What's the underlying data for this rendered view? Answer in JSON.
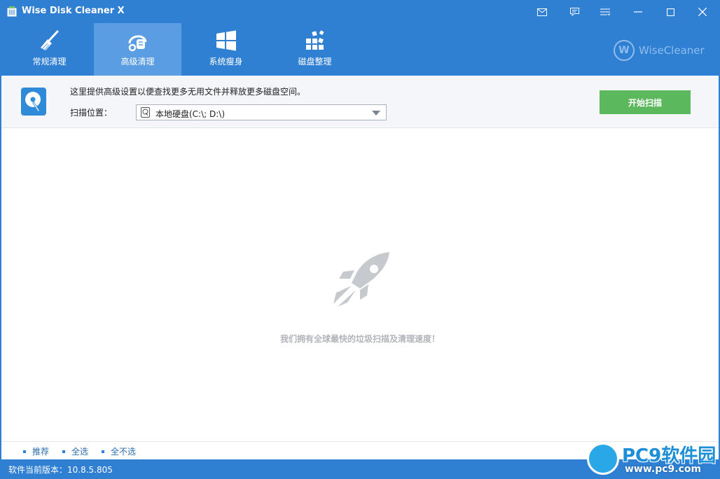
{
  "window": {
    "title": "Wise Disk Cleaner X"
  },
  "titlebar_buttons": [
    "mail-icon",
    "feedback-icon",
    "menu-icon",
    "minimize-icon",
    "maximize-icon",
    "close-icon"
  ],
  "tabs": [
    {
      "label": "常规清理",
      "icon": "broom-icon"
    },
    {
      "label": "高级清理",
      "icon": "vacuum-icon",
      "active": true
    },
    {
      "label": "系统瘦身",
      "icon": "windows-icon"
    },
    {
      "label": "磁盘整理",
      "icon": "defrag-icon"
    }
  ],
  "brand": {
    "letter": "W",
    "name": "WiseCleaner"
  },
  "info": {
    "description": "这里提供高级设置以便查找更多无用文件并释放更多磁盘空间。",
    "scan_label": "扫描位置：",
    "scan_location": "本地硬盘(C:\\; D:\\)",
    "start_button": "开始扫描"
  },
  "main": {
    "slogan": "我们拥有全球最快的垃圾扫描及清理速度！"
  },
  "bottom_links": [
    "推荐",
    "全选",
    "全不选"
  ],
  "status": {
    "version": "软件当前版本：10.8.5.805"
  },
  "watermark": {
    "text": "PC9软件园",
    "url": "www.pc9.com"
  },
  "colors": {
    "primary": "#2f7fd3",
    "active_tab": "#5a9de3",
    "start_button": "#5cb85c"
  }
}
